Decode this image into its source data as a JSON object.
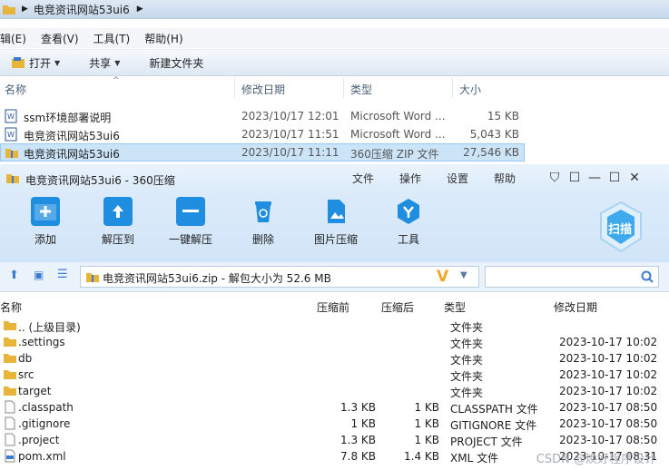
{
  "explorer": {
    "breadcrumb": "电竞资讯网站53ui6",
    "menu": [
      "辑(E)",
      "查看(V)",
      "工具(T)",
      "帮助(H)"
    ],
    "toolbar": {
      "open": "打开",
      "share": "共享",
      "new_folder": "新建文件夹"
    },
    "columns": [
      "名称",
      "修改日期",
      "类型",
      "大小"
    ],
    "files": [
      {
        "name": "ssm环境部署说明",
        "date": "2023/10/17 12:01",
        "type": "Microsoft Word ...",
        "size": "15 KB",
        "icon": "word-doc-icon"
      },
      {
        "name": "电竞资讯网站53ui6",
        "date": "2023/10/17 11:51",
        "type": "Microsoft Word ...",
        "size": "5,043 KB",
        "icon": "word-doc-icon"
      },
      {
        "name": "电竞资讯网站53ui6",
        "date": "2023/10/17 11:11",
        "type": "360压缩 ZIP 文件",
        "size": "27,546 KB",
        "icon": "zip-archive-icon"
      }
    ]
  },
  "archiver": {
    "title": "电竞资讯网站53ui6 - 360压缩",
    "menu": [
      "文件",
      "操作",
      "设置",
      "帮助"
    ],
    "tools": [
      "添加",
      "解压到",
      "一键解压",
      "删除",
      "图片压缩",
      "工具"
    ],
    "scan_label": "扫描",
    "address": "电竞资讯网站53ui6.zip - 解包大小为 52.6 MB",
    "columns": [
      "名称",
      "压缩前",
      "压缩后",
      "类型",
      "修改日期"
    ],
    "entries": [
      {
        "name": ".. (上级目录)",
        "before": "",
        "after": "",
        "type": "文件夹",
        "date": "",
        "icon": "folder-icon"
      },
      {
        "name": ".settings",
        "before": "",
        "after": "",
        "type": "文件夹",
        "date": "2023-10-17 10:02",
        "icon": "folder-icon"
      },
      {
        "name": "db",
        "before": "",
        "after": "",
        "type": "文件夹",
        "date": "2023-10-17 10:02",
        "icon": "folder-icon"
      },
      {
        "name": "src",
        "before": "",
        "after": "",
        "type": "文件夹",
        "date": "2023-10-17 10:02",
        "icon": "folder-icon"
      },
      {
        "name": "target",
        "before": "",
        "after": "",
        "type": "文件夹",
        "date": "2023-10-17 10:02",
        "icon": "folder-icon"
      },
      {
        "name": ".classpath",
        "before": "1.3 KB",
        "after": "1 KB",
        "type": "CLASSPATH 文件",
        "date": "2023-10-17 08:50",
        "icon": "file-icon"
      },
      {
        "name": ".gitignore",
        "before": "1 KB",
        "after": "1 KB",
        "type": "GITIGNORE 文件",
        "date": "2023-10-17 08:50",
        "icon": "file-icon"
      },
      {
        "name": ".project",
        "before": "1.3 KB",
        "after": "1 KB",
        "type": "PROJECT 文件",
        "date": "2023-10-17 08:50",
        "icon": "file-icon"
      },
      {
        "name": "pom.xml",
        "before": "7.8 KB",
        "after": "1.4 KB",
        "type": "XML 文件",
        "date": "2023-10-17 08:31",
        "icon": "xml-file-icon"
      }
    ]
  },
  "watermark": "CSDN @焕好程序设计",
  "colors": {
    "accent_blue": "#1f8ee0",
    "selection": "#cce4f7",
    "folder": "#e8b43a",
    "orange_v": "#f5a623"
  }
}
